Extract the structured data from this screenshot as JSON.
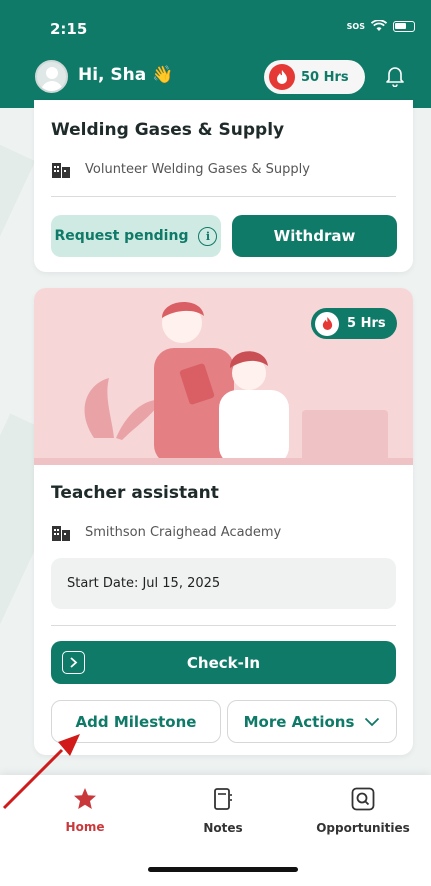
{
  "status_bar": {
    "time": "2:15",
    "sos": "SOS"
  },
  "header": {
    "greeting": "Hi, Sha 👋",
    "hours": "50 Hrs"
  },
  "card1": {
    "title": "Welding Gases & Supply",
    "organization": "Volunteer Welding Gases & Supply",
    "pending_label": "Request pending",
    "withdraw_label": "Withdraw"
  },
  "card2": {
    "hours_badge": "5 Hrs",
    "title": "Teacher assistant",
    "organization": "Smithson Craighead Academy",
    "start_date": "Start Date: Jul 15, 2025",
    "checkin_label": "Check-In",
    "milestone_label": "Add Milestone",
    "more_actions_label": "More Actions"
  },
  "bottom_nav": {
    "items": [
      {
        "label": "Home",
        "icon": "star-icon",
        "active": true
      },
      {
        "label": "Notes",
        "icon": "notebook-icon",
        "active": false
      },
      {
        "label": "Opportunities",
        "icon": "search-square-icon",
        "active": false
      }
    ]
  },
  "colors": {
    "primary": "#0f7a68",
    "accent": "#c9393b",
    "pending_bg": "#cfeae2",
    "illustration_bg": "#f6d6d7"
  }
}
